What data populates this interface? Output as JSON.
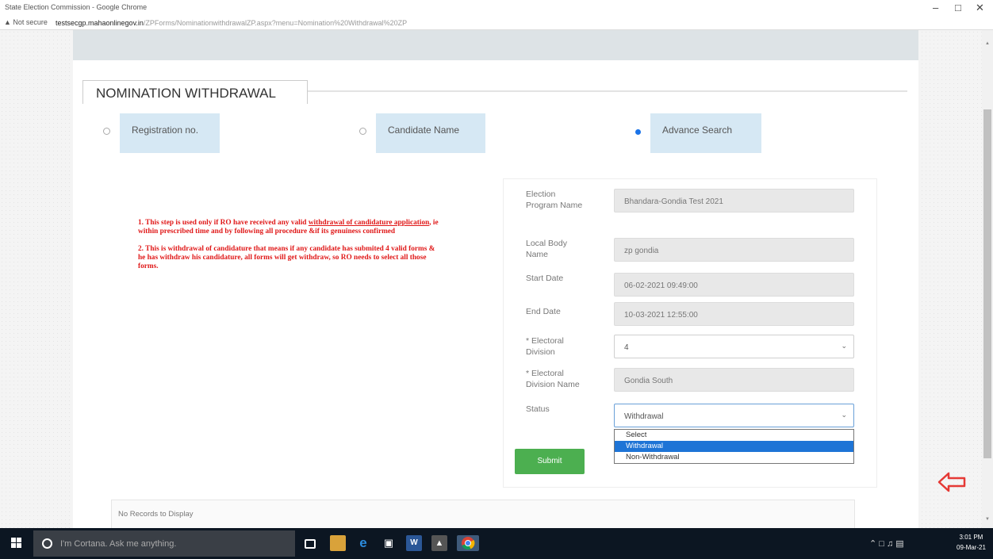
{
  "window": {
    "title": "State Election Commission - Google Chrome",
    "minimize": "–",
    "maximize": "□",
    "close": "✕"
  },
  "address_bar": {
    "security": "▲ Not secure",
    "host": "testsecgp.mahaonlinegov.in",
    "path": "/ZPForms/NominationwithdrawalZP.aspx?menu=Nomination%20Withdrawal%20ZP"
  },
  "page": {
    "section_title": "NOMINATION WITHDRAWAL",
    "search_options": [
      {
        "label": "Registration no.",
        "selected": false
      },
      {
        "label": "Candidate Name",
        "selected": false
      },
      {
        "label": "Advance Search",
        "selected": true
      }
    ],
    "notes": {
      "note1_prefix": "1. This step is used only if RO have received any valid ",
      "note1_underlined": "withdrawal of candidature application",
      "note1_suffix": ", ie within prescribed time and by following all procedure &if its genuiness confirmed",
      "note2": "2. This is withdrawal of candidature that means if any candidate has submited 4 valid forms & he has withdraw his candidature, all forms will get withdraw, so RO needs to select all those forms."
    },
    "form": {
      "election_program_label": "Election Program Name",
      "election_program_value": "Bhandara-Gondia Test 2021",
      "local_body_label": "Local Body Name",
      "local_body_value": "zp gondia",
      "start_date_label": "Start Date",
      "start_date_value": "06-02-2021 09:49:00",
      "end_date_label": "End Date",
      "end_date_value": "10-03-2021 12:55:00",
      "electoral_division_label": "* Electoral Division",
      "electoral_division_value": "4",
      "electoral_division_name_label": "* Electoral Division Name",
      "electoral_division_name_value": "Gondia South",
      "status_label": "Status",
      "status_value": "Withdrawal",
      "status_options": [
        "Select",
        "Withdrawal",
        "Non-Withdrawal"
      ],
      "status_selected_index": 1,
      "submit_label": "Submit"
    },
    "records_message": "No Records to Display"
  },
  "taskbar": {
    "cortana_placeholder": "I'm Cortana. Ask me anything.",
    "clock_time": "3:01 PM",
    "clock_date": "09-Mar-21"
  },
  "colors": {
    "accent_blue": "#1a73e8",
    "radio_label_bg": "#d6e8f4",
    "submit_green": "#4caf50",
    "note_red": "#e01818",
    "arrow_red": "#e53935",
    "taskbar": "#0c1622"
  }
}
